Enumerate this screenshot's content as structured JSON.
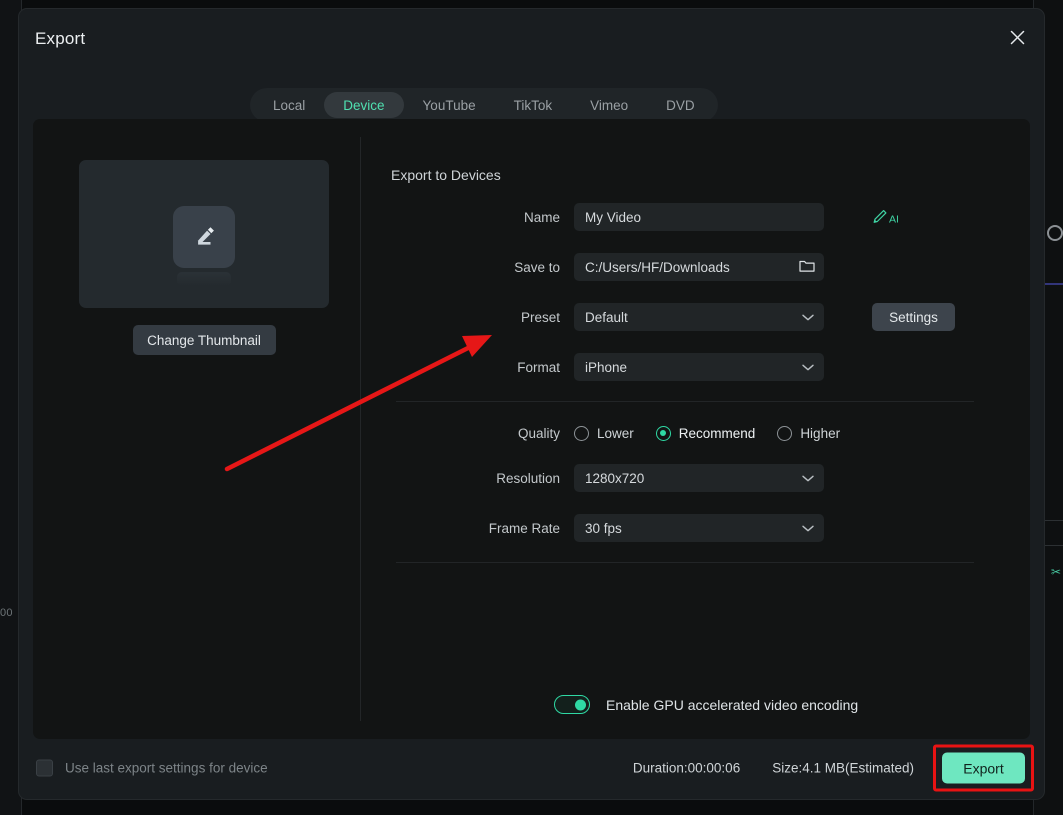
{
  "window": {
    "title": "Export",
    "close_icon": "close-icon"
  },
  "tabs": [
    {
      "label": "Local",
      "active": false
    },
    {
      "label": "Device",
      "active": true
    },
    {
      "label": "YouTube",
      "active": false
    },
    {
      "label": "TikTok",
      "active": false
    },
    {
      "label": "Vimeo",
      "active": false
    },
    {
      "label": "DVD",
      "active": false
    }
  ],
  "thumbnail": {
    "placeholder_icon": "edit-pencil-icon",
    "change_button": "Change Thumbnail"
  },
  "form": {
    "section_title": "Export to Devices",
    "name": {
      "label": "Name",
      "value": "My Video",
      "placeholder": "My Video",
      "ai_icon": "ai-pencil-icon",
      "ai_text": "AI"
    },
    "save_to": {
      "label": "Save to",
      "value": "C:/Users/HF/Downloads",
      "placeholder": "C:/Users/HF/Downloads",
      "browse_icon": "folder-icon"
    },
    "preset": {
      "label": "Preset",
      "value": "Default",
      "settings_button": "Settings"
    },
    "format": {
      "label": "Format",
      "value": "iPhone"
    },
    "quality": {
      "label": "Quality",
      "options": [
        {
          "label": "Lower",
          "selected": false
        },
        {
          "label": "Recommend",
          "selected": true
        },
        {
          "label": "Higher",
          "selected": false
        }
      ]
    },
    "resolution": {
      "label": "Resolution",
      "value": "1280x720"
    },
    "frame_rate": {
      "label": "Frame Rate",
      "value": "30 fps"
    },
    "gpu": {
      "label": "Enable GPU accelerated video encoding",
      "enabled": true
    }
  },
  "footer": {
    "use_last_settings": {
      "label": "Use last export settings for device",
      "checked": false
    },
    "duration": "Duration:00:00:06",
    "size": "Size:4.1 MB(Estimated)",
    "export_button": "Export"
  },
  "background": {
    "left_timecode": "00",
    "right_glyph": "✂"
  },
  "colors": {
    "accent": "#2fd9a4",
    "export_button": "#6ee7c0",
    "highlight_box": "#e81313",
    "dialog_bg": "#191d20",
    "panel_bg": "#121414",
    "field_bg": "#212527"
  }
}
